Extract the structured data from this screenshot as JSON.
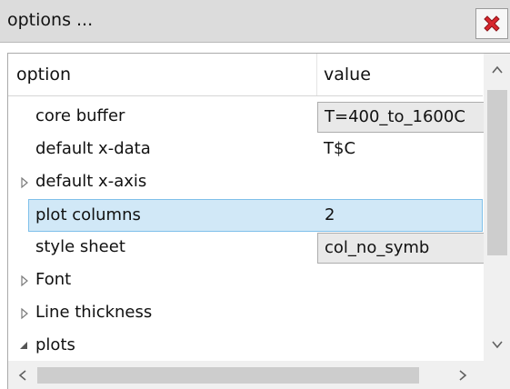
{
  "window": {
    "title": "options ..."
  },
  "grid": {
    "headers": {
      "option": "option",
      "value": "value"
    },
    "rows": [
      {
        "label": "core buffer",
        "value": "T=400_to_1600C",
        "kind": "dropdown"
      },
      {
        "label": "default x-data",
        "value": "T$C",
        "kind": "text"
      },
      {
        "label": "default x-axis",
        "value": "",
        "kind": "collapsed-group"
      },
      {
        "label": "plot columns",
        "value": "2",
        "kind": "text-selected"
      },
      {
        "label": "style sheet",
        "value": "col_no_symb",
        "kind": "dropdown"
      },
      {
        "label": "Font",
        "value": "",
        "kind": "collapsed-group"
      },
      {
        "label": "Line thickness",
        "value": "",
        "kind": "collapsed-group"
      },
      {
        "label": "plots",
        "value": "",
        "kind": "expanded-group"
      }
    ]
  },
  "icons": {
    "close": "close-x-icon",
    "collapsed": "triangle-right-icon",
    "expanded": "triangle-down-icon",
    "scroll_up": "chevron-up-icon",
    "scroll_down": "chevron-down-icon",
    "scroll_left": "chevron-left-icon",
    "scroll_right": "chevron-right-icon"
  },
  "colors": {
    "close_icon": "#d9262d",
    "selection_fill": "#d1e8f7",
    "selection_border": "#7fc0ea",
    "titlebar": "#dcdcdc"
  }
}
